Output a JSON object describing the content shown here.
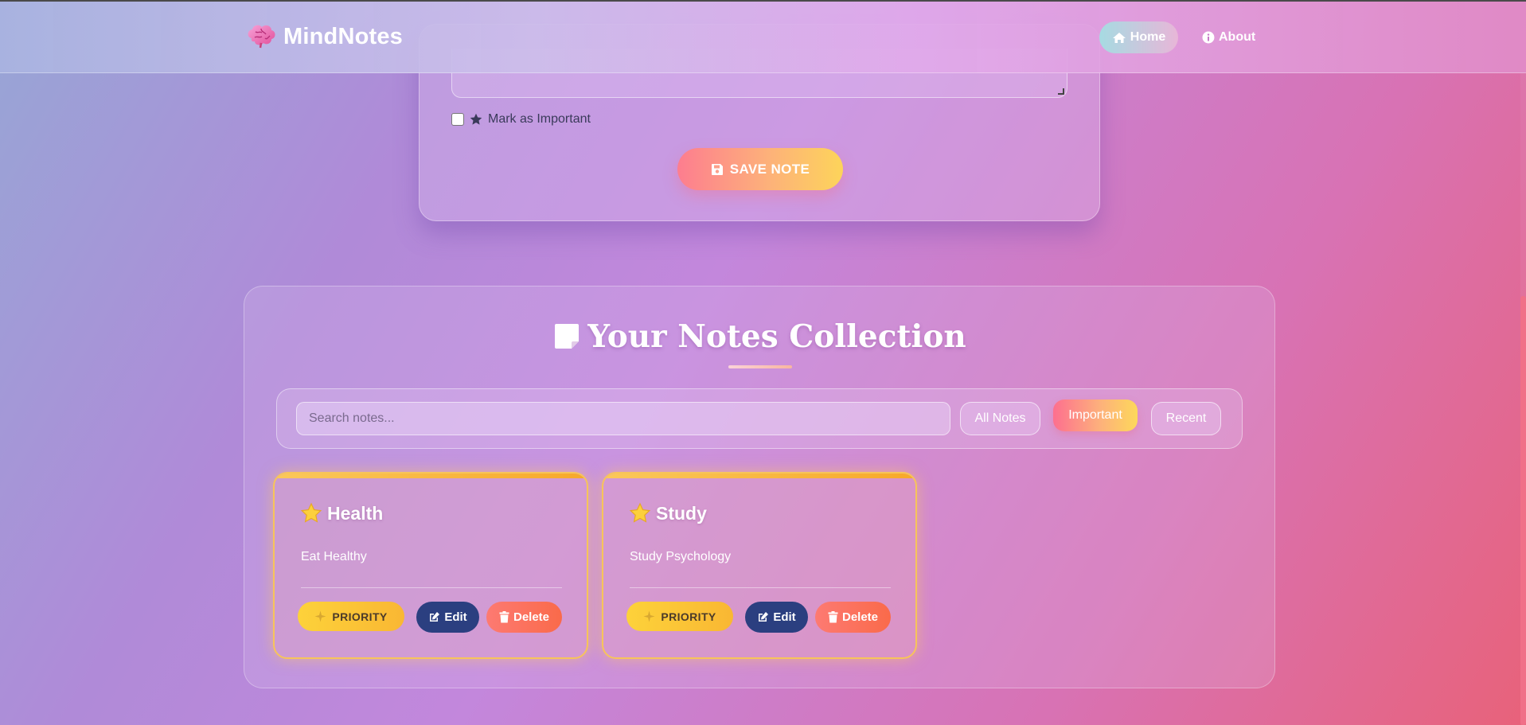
{
  "brand": {
    "name": "MindNotes",
    "icon": "brain-icon"
  },
  "nav": {
    "home_label": "Home",
    "about_label": "About"
  },
  "form": {
    "important_label": "Mark as Important",
    "save_label": "SAVE NOTE"
  },
  "notes": {
    "title": "Your Notes Collection",
    "search_placeholder": "Search notes...",
    "filters": [
      {
        "label": "All Notes",
        "active": false
      },
      {
        "label": "Important",
        "active": true
      },
      {
        "label": "Recent",
        "active": false
      }
    ],
    "cards": [
      {
        "title": "Health",
        "content": "Eat Healthy",
        "badge": "PRIORITY",
        "edit_label": "Edit",
        "delete_label": "Delete"
      },
      {
        "title": "Study",
        "content": "Study Psychology",
        "badge": "PRIORITY",
        "edit_label": "Edit",
        "delete_label": "Delete"
      }
    ]
  },
  "colors": {
    "accent_gradient_start": "#fd7d8f",
    "accent_gradient_end": "#fdd45a",
    "priority_border": "#f7c45a",
    "edit_button": "#2b3f80",
    "delete_button": "#fa6a4a"
  }
}
